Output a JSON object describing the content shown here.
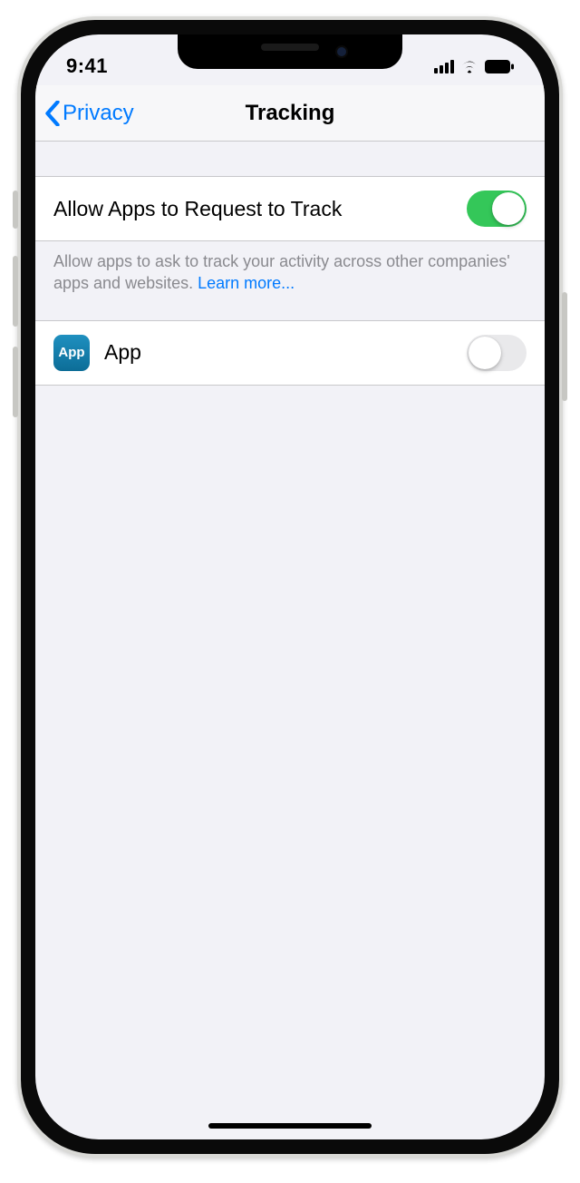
{
  "status": {
    "time": "9:41"
  },
  "nav": {
    "back_label": "Privacy",
    "title": "Tracking"
  },
  "allow": {
    "label": "Allow Apps to Request to Track",
    "on": true,
    "footer": "Allow apps to ask to track your activity across other companies' apps and websites. ",
    "learn_more": "Learn more..."
  },
  "apps": [
    {
      "name": "App",
      "icon_text": "App",
      "tracking_on": false
    }
  ]
}
